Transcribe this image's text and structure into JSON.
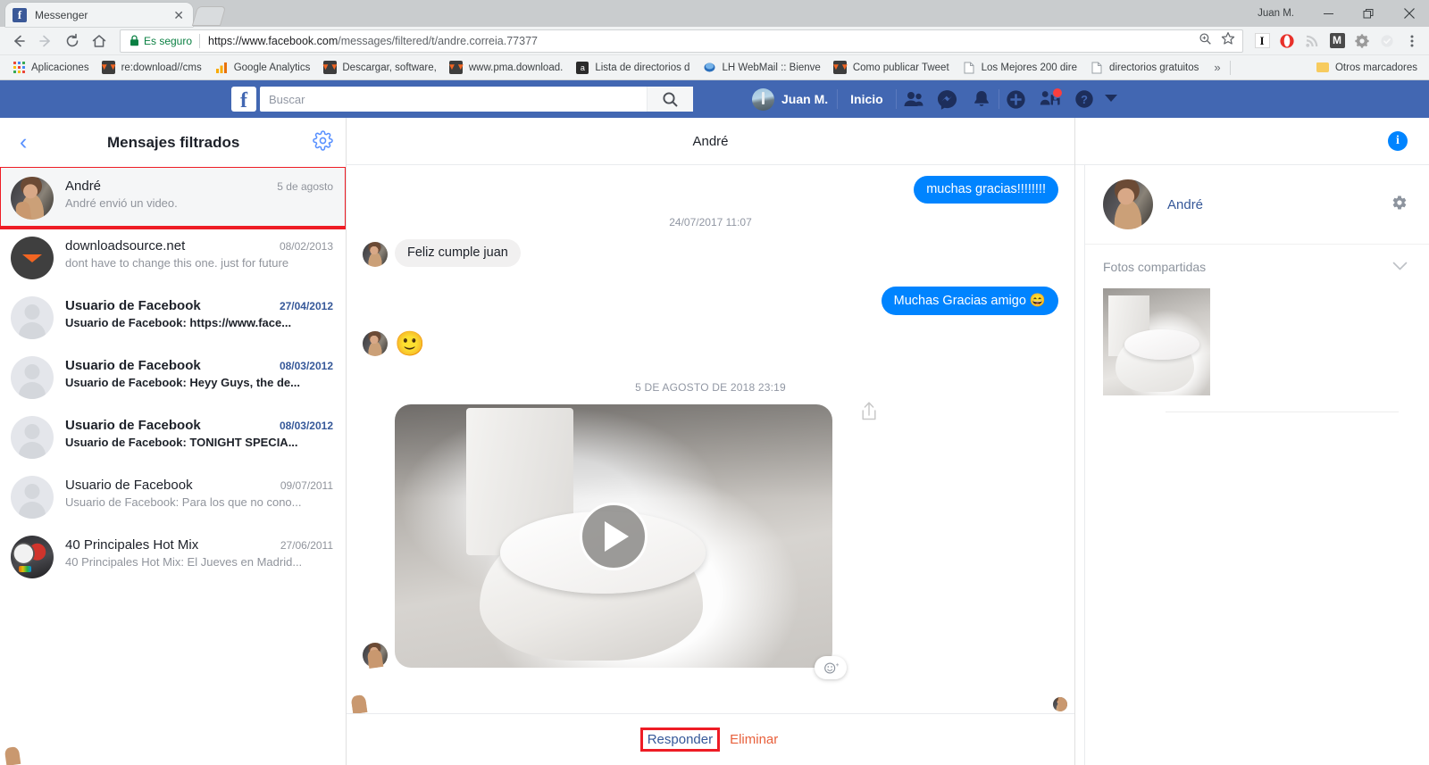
{
  "browser": {
    "tab": {
      "title": "Messenger",
      "favicon": "facebook-favicon",
      "close": "✕"
    },
    "window": {
      "user": "Juan M.",
      "minimize": "—",
      "restore": "❐",
      "close": "✕"
    },
    "toolbar": {
      "back": "←",
      "forward": "→",
      "reload": "↻",
      "home": "⌂",
      "security_label": "Es seguro",
      "url_host": "https://www.facebook.com",
      "url_path": "/messages/filtered/t/andre.correia.77377",
      "zoom_icon": "zoom-icon",
      "bookmark_star": "☆",
      "menu": "⋮"
    },
    "extensions": [
      {
        "name": "instapaper-extension",
        "glyph": "I"
      },
      {
        "name": "opera-extension",
        "glyph": "O"
      },
      {
        "name": "rss-extension",
        "glyph": "rss"
      },
      {
        "name": "mailbox-extension",
        "glyph": "M"
      },
      {
        "name": "settings-extension",
        "glyph": "gear"
      },
      {
        "name": "disabled-extension",
        "glyph": "●"
      }
    ],
    "bookmarks": [
      {
        "label": "Aplicaciones",
        "icon": "apps-grid-icon"
      },
      {
        "label": "re:download//cms",
        "icon": "downloadsource-icon"
      },
      {
        "label": "Google Analytics",
        "icon": "analytics-icon"
      },
      {
        "label": "Descargar, software,",
        "icon": "downloadsource-icon"
      },
      {
        "label": "www.pma.download.",
        "icon": "downloadsource-icon"
      },
      {
        "label": "Lista de directorios d",
        "icon": "alexa-icon"
      },
      {
        "label": "LH WebMail :: Bienve",
        "icon": "webmail-icon"
      },
      {
        "label": "Como publicar Tweet",
        "icon": "downloadsource-icon"
      },
      {
        "label": "Los Mejores 200 dire",
        "icon": "page-icon"
      },
      {
        "label": "directorios gratuitos",
        "icon": "page-icon"
      }
    ],
    "bookmarks_overflow": "»",
    "other_bookmarks": {
      "label": "Otros marcadores",
      "icon": "folder-icon"
    }
  },
  "fb_header": {
    "logo": "f",
    "search": {
      "placeholder": "Buscar",
      "value": "",
      "button_icon": "search-icon"
    },
    "profile_name": "Juan M.",
    "home_label": "Inicio",
    "icons": [
      {
        "name": "friend-requests-icon",
        "badge": false
      },
      {
        "name": "messenger-icon",
        "badge": false
      },
      {
        "name": "notifications-bell-icon",
        "badge": false
      },
      {
        "name": "create-plus-icon",
        "badge": false
      },
      {
        "name": "account-settings-icon",
        "badge": true
      }
    ],
    "help_icon": "help-question-icon",
    "caret_icon": "chevron-down-icon"
  },
  "message_list": {
    "back_icon": "‹",
    "title": "Mensajes filtrados",
    "settings_icon": "gear-icon",
    "conversations": [
      {
        "name": "André",
        "date": "5 de agosto",
        "snippet": "André envió un video.",
        "avatar": "av-andre",
        "unread": false,
        "active": true,
        "highlighted": true
      },
      {
        "name": "downloadsource.net",
        "date": "08/02/2013",
        "snippet": "dont have to change this one. just for future",
        "avatar": "av-ds",
        "unread": false,
        "active": false,
        "highlighted": false
      },
      {
        "name": "Usuario de Facebook",
        "date": "27/04/2012",
        "snippet": "Usuario de Facebook: https://www.face...",
        "avatar": "av-generic",
        "unread": true,
        "active": false,
        "highlighted": false
      },
      {
        "name": "Usuario de Facebook",
        "date": "08/03/2012",
        "snippet": "Usuario de Facebook: Heyy Guys, the de...",
        "avatar": "av-generic",
        "unread": true,
        "active": false,
        "highlighted": false
      },
      {
        "name": "Usuario de Facebook",
        "date": "08/03/2012",
        "snippet": "Usuario de Facebook: TONIGHT SPECIA...",
        "avatar": "av-generic",
        "unread": true,
        "active": false,
        "highlighted": false
      },
      {
        "name": "Usuario de Facebook",
        "date": "09/07/2011",
        "snippet": "Usuario de Facebook: Para los que no cono...",
        "avatar": "av-generic",
        "unread": false,
        "active": false,
        "highlighted": false
      },
      {
        "name": "40 Principales Hot Mix",
        "date": "27/06/2011",
        "snippet": "40 Principales Hot Mix: El Jueves en Madrid...",
        "avatar": "av-40p",
        "unread": false,
        "active": false,
        "highlighted": false
      }
    ]
  },
  "thread": {
    "title": "André",
    "messages": [
      {
        "kind": "bubble",
        "side": "out",
        "text": "muchas gracias!!!!!!!!"
      },
      {
        "kind": "timestamp",
        "text": "24/07/2017 11:07"
      },
      {
        "kind": "bubble",
        "side": "in",
        "text": "Feliz cumple juan"
      },
      {
        "kind": "bubble",
        "side": "out",
        "text": "Muchas Gracias amigo 😄"
      },
      {
        "kind": "emoji",
        "side": "in",
        "text": "🙂"
      },
      {
        "kind": "timestamp",
        "text": "5 DE AGOSTO DE 2018 23:19"
      },
      {
        "kind": "video",
        "side": "in",
        "play_icon": "play-button-icon"
      }
    ],
    "share_icon": "share-icon",
    "react_icon": "add-reaction-icon",
    "footer": {
      "reply_label": "Responder",
      "delete_label": "Eliminar"
    }
  },
  "details": {
    "info_icon": "i",
    "person_name": "André",
    "person_settings_icon": "gear-icon",
    "shared_photos_label": "Fotos compartidas",
    "collapse_icon": "chevron-down-icon",
    "photos_count": 1
  },
  "colors": {
    "fb_blue": "#4267b2",
    "bubble_out": "#0084ff",
    "bubble_in": "#f1f0f0",
    "link_blue": "#365899",
    "accent_red": "#ee1c25",
    "delete_orange": "#e8603c",
    "secure_green": "#0b8043"
  }
}
